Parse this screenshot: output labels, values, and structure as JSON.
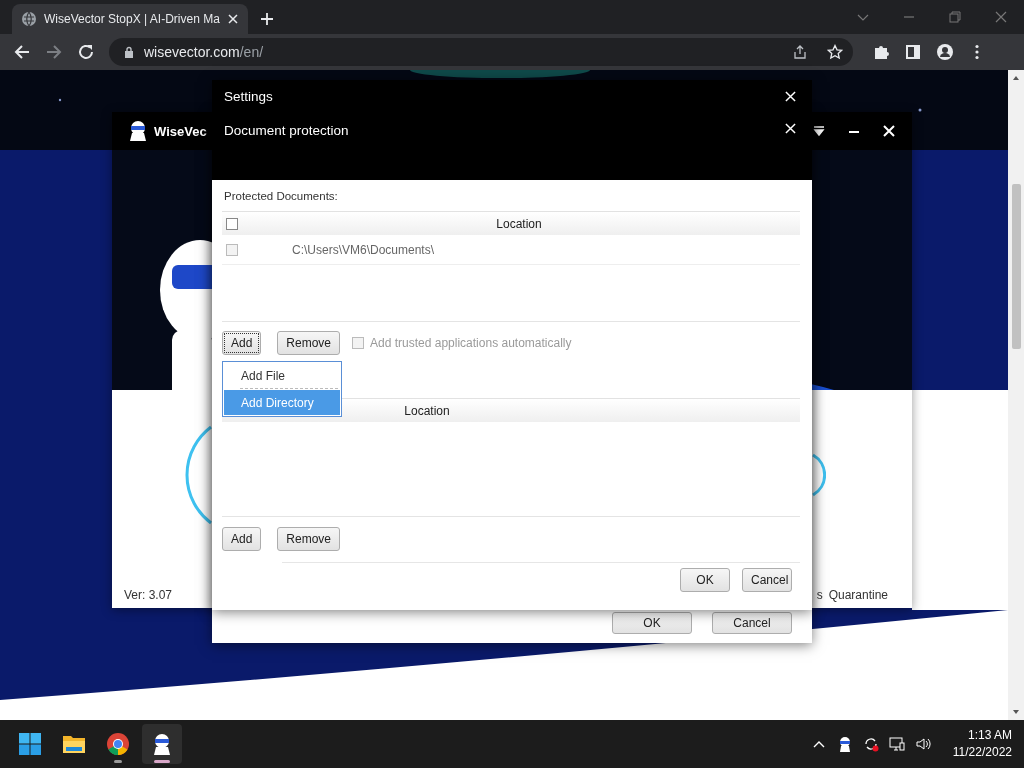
{
  "browser": {
    "tab_title": "WiseVector StopX | AI-Driven Ma",
    "url_host": "wisevector.com",
    "url_path": "/en/",
    "forward_enabled": false
  },
  "app_window": {
    "title": "WiseVec",
    "version": "Ver: 3.07",
    "nav_items": [
      "s",
      "Quarantine"
    ]
  },
  "settings_dialog": {
    "title": "Settings",
    "buttons": [
      "OK",
      "Cancel"
    ]
  },
  "document_protection": {
    "title": "Document protection",
    "section_label": "Protected Documents:",
    "documents_table": {
      "columns": [
        "Location"
      ],
      "header_checked": false,
      "rows": [
        {
          "location": "C:\\Users\\VM6\\Documents\\",
          "checked": false
        }
      ]
    },
    "buttons": [
      {
        "label": "Add",
        "focused": true
      },
      {
        "label": "Remove",
        "focused": false
      }
    ],
    "auto_trust": {
      "label": "Add trusted applications automatically",
      "checked": false,
      "disabled": true
    },
    "add_menu": [
      {
        "label": "Add File",
        "selected": false
      },
      {
        "label": "Add Directory",
        "selected": true
      }
    ],
    "applications_table": {
      "columns": [
        "Location"
      ]
    },
    "app_buttons": [
      {
        "label": "Add",
        "focused": false
      },
      {
        "label": "Remove",
        "focused": false
      }
    ],
    "dialog_buttons": [
      "OK",
      "Cancel"
    ]
  },
  "taskbar": {
    "apps": [
      {
        "kind": "start",
        "running": false,
        "active": false
      },
      {
        "kind": "folder",
        "running": false,
        "active": false
      },
      {
        "kind": "chrome",
        "running": true,
        "active": false
      },
      {
        "kind": "robot",
        "running": true,
        "active": true
      }
    ],
    "time": "1:13 AM",
    "date": "11/22/2022"
  }
}
